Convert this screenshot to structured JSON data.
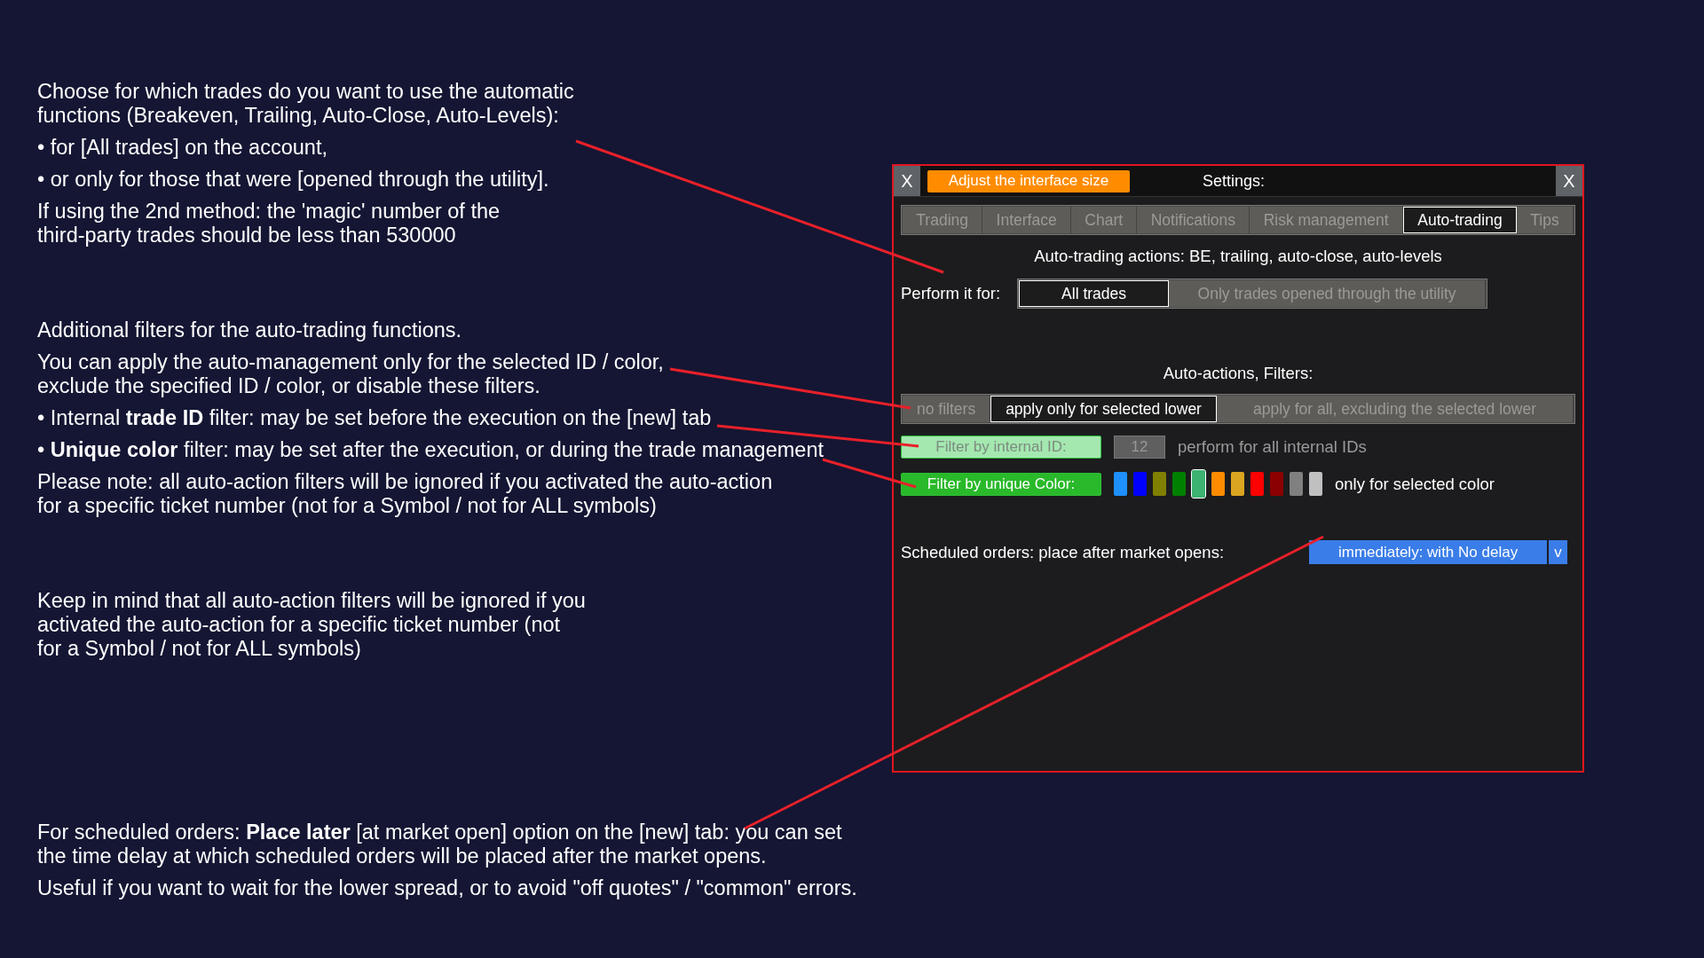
{
  "notes": [
    {
      "paragraphs": [
        "Choose for which trades do you want to use the automatic functions (Breakeven, Trailing, Auto-Close, Auto-Levels):",
        "• for [All trades] on the account,",
        "• or only for those that were [opened through the utility].",
        "If using the 2nd method: the 'magic' number of the third-party trades should be less than 530000"
      ]
    },
    {
      "paragraphs": [
        "Additional filters for the auto-trading functions.",
        "You can apply the auto-management only for the selected ID / color, exclude the specified ID / color, or disable these filters.",
        "• Internal **trade ID** filter: may be set before the execution on the [new] tab",
        "• **Unique color** filter: may be set after the execution, or during the trade management",
        "Please note: all auto-action filters will be ignored if you activated the auto-action for a specific ticket number (not for a Symbol / not for ALL symbols)"
      ]
    },
    {
      "paragraphs": [
        "Keep in mind that all auto-action filters will be ignored if you activated the auto-action for a specific ticket number (not for a Symbol / not for ALL symbols)"
      ]
    },
    {
      "paragraphs": [
        "For scheduled orders: **Place later** [at market open] option on the [new] tab: you can set the time delay at which scheduled orders will be placed after the market opens.",
        "Useful if you want to wait for the lower spread, or to avoid \"off quotes\" / \"common\" errors."
      ]
    }
  ],
  "panel": {
    "close_left": "X",
    "resize_button": "Adjust the interface size",
    "title": "Settings:",
    "close_right": "X",
    "tabs": [
      {
        "label": "Trading",
        "selected": false
      },
      {
        "label": "Interface",
        "selected": false
      },
      {
        "label": "Chart",
        "selected": false
      },
      {
        "label": "Notifications",
        "selected": false
      },
      {
        "label": "Risk management",
        "selected": false
      },
      {
        "label": "Auto-trading",
        "selected": true
      },
      {
        "label": "Tips",
        "selected": false
      }
    ],
    "heading": "Auto-trading actions: BE, trailing, auto-close, auto-levels",
    "perform_label": "Perform it for:",
    "perform_options": [
      {
        "label": "All trades",
        "selected": true
      },
      {
        "label": "Only trades opened through the utility",
        "selected": false
      }
    ],
    "filters_heading": "Auto-actions, Filters:",
    "filter_modes": [
      {
        "label": "no filters",
        "selected": false
      },
      {
        "label": "apply only for selected lower",
        "selected": true
      },
      {
        "label": "apply for all, excluding the selected lower",
        "selected": false
      }
    ],
    "id_filter": {
      "label": "Filter by internal ID:",
      "active": false,
      "value": "12",
      "note": "perform for all internal IDs"
    },
    "color_filter": {
      "label": "Filter by unique Color:",
      "active": true,
      "note": "only for selected color",
      "colors": [
        {
          "color": "#1e90ff",
          "selected": false
        },
        {
          "color": "#0000ff",
          "selected": false
        },
        {
          "color": "#808000",
          "selected": false
        },
        {
          "color": "#008000",
          "selected": false
        },
        {
          "color": "#3cb371",
          "selected": true
        },
        {
          "color": "#ff8c00",
          "selected": false
        },
        {
          "color": "#daa520",
          "selected": false
        },
        {
          "color": "#ff0000",
          "selected": false
        },
        {
          "color": "#8b0000",
          "selected": false
        },
        {
          "color": "#808080",
          "selected": false
        },
        {
          "color": "#c0c0c0",
          "selected": false
        }
      ]
    },
    "scheduled_label": "Scheduled orders: place after market opens:",
    "scheduled_value": "immediately: with No delay",
    "scheduled_caret": "v"
  }
}
